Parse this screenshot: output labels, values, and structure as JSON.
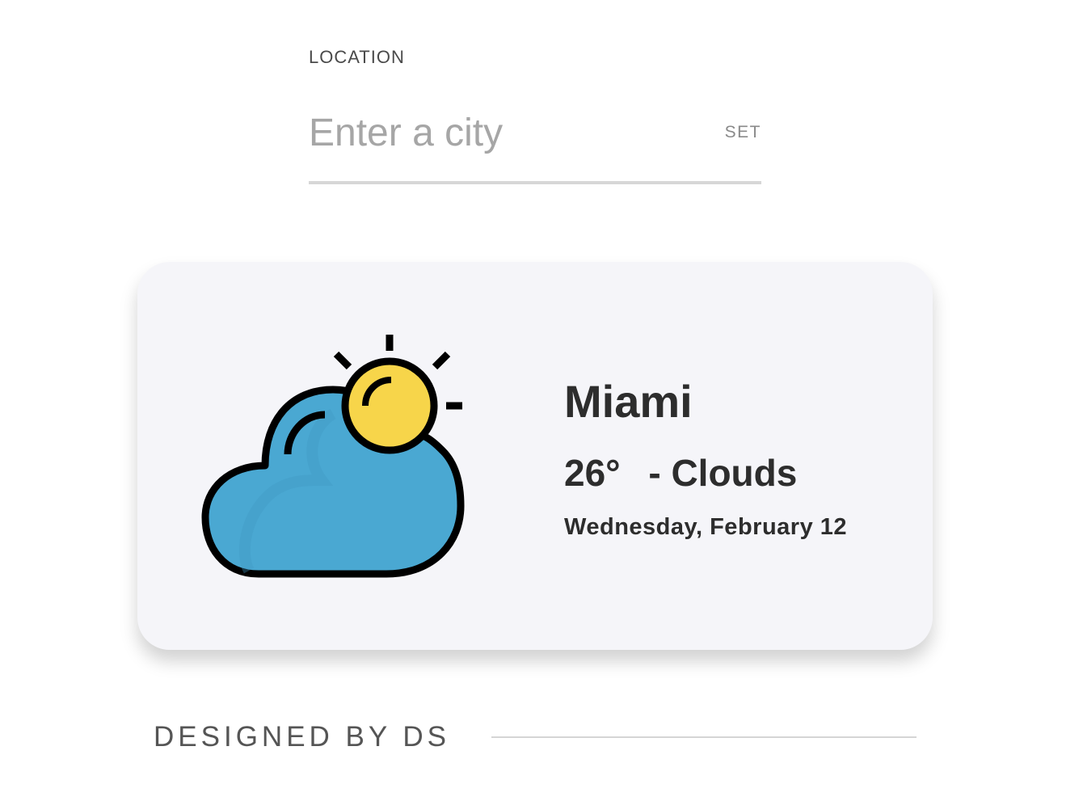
{
  "location": {
    "label": "LOCATION",
    "input_placeholder": "Enter a city",
    "input_value": "",
    "set_label": "SET"
  },
  "weather": {
    "city": "Miami",
    "temperature": "26°",
    "separator": "-",
    "condition": "Clouds",
    "date": "Wednesday, February 12",
    "icon": "partly-cloudy-icon",
    "colors": {
      "cloud": "#4aa8d2",
      "sun": "#f7d54a",
      "outline": "#000000",
      "card_background": "#f5f5f9"
    }
  },
  "footer": {
    "text": "DESIGNED BY DS"
  }
}
